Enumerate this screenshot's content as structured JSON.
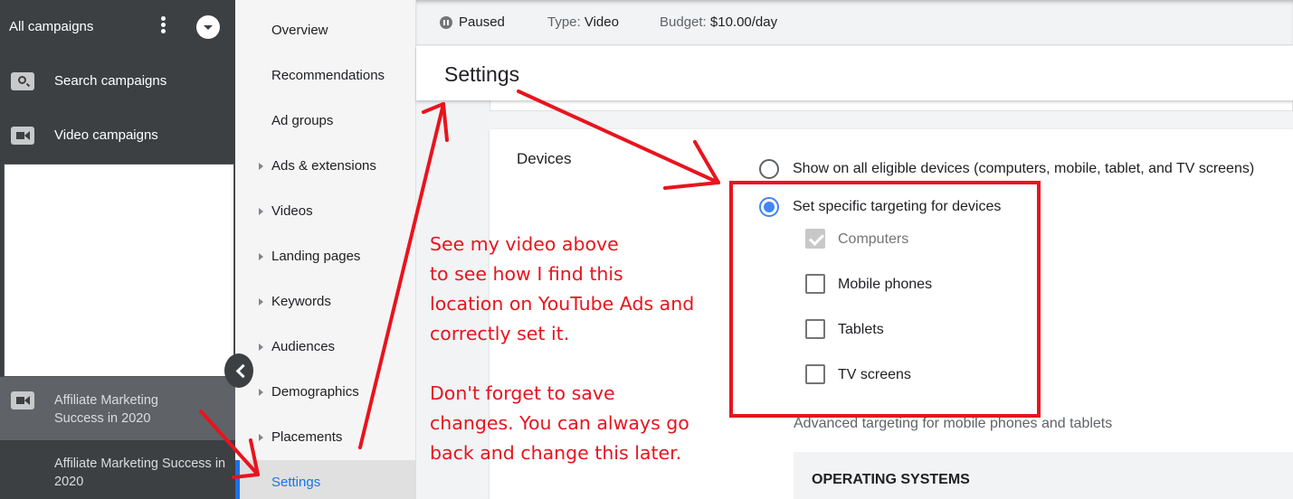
{
  "left_nav": {
    "title": "All campaigns",
    "more_icon": "kebab-vertical-icon",
    "dropdown_icon": "dropdown-circle-icon",
    "items": [
      {
        "label": "Search campaigns",
        "icon": "search-icon"
      },
      {
        "label": "Video campaigns",
        "icon": "video-camera-icon"
      }
    ],
    "campaign": {
      "label": "Affiliate Marketing Success in 2020",
      "icon": "video-camera-icon"
    },
    "ad_group": {
      "label": "Affiliate Marketing Success in 2020"
    },
    "collapse_icon": "chevron-left-icon"
  },
  "page_nav": {
    "items": [
      {
        "label": "Overview",
        "expandable": false
      },
      {
        "label": "Recommendations",
        "expandable": false
      },
      {
        "label": "Ad groups",
        "expandable": false
      },
      {
        "label": "Ads & extensions",
        "expandable": true
      },
      {
        "label": "Videos",
        "expandable": true
      },
      {
        "label": "Landing pages",
        "expandable": true
      },
      {
        "label": "Keywords",
        "expandable": true
      },
      {
        "label": "Audiences",
        "expandable": true
      },
      {
        "label": "Demographics",
        "expandable": true
      },
      {
        "label": "Placements",
        "expandable": true
      },
      {
        "label": "Settings",
        "expandable": false,
        "active": true
      }
    ]
  },
  "status_bar": {
    "status": "Paused",
    "status_icon": "pause-circle-icon",
    "type_label": "Type:",
    "type_value": "Video",
    "budget_label": "Budget:",
    "budget_value": "$10.00/day"
  },
  "settings": {
    "title": "Settings",
    "devices": {
      "label": "Devices",
      "options": [
        {
          "label": "Show on all eligible devices (computers, mobile, tablet, and TV screens)",
          "selected": false
        },
        {
          "label": "Set specific targeting for devices",
          "selected": true
        }
      ],
      "checkboxes": [
        {
          "label": "Computers",
          "checked": true,
          "disabled": true
        },
        {
          "label": "Mobile phones",
          "checked": false,
          "disabled": false
        },
        {
          "label": "Tablets",
          "checked": false,
          "disabled": false
        },
        {
          "label": "TV screens",
          "checked": false,
          "disabled": false
        }
      ],
      "advanced_text": "Advanced targeting for mobile phones and tablets",
      "os_heading": "OPERATING SYSTEMS"
    }
  },
  "annotations": {
    "color": "#e8141e",
    "note_1": "See my video above\nto see how I find this\nlocation on YouTube Ads and\ncorrectly set it.",
    "note_2": "Don't forget to save\nchanges. You can always go\nback and change this later."
  },
  "colors": {
    "sidebar_dark": "#3c4043",
    "accent_blue": "#1a73e8",
    "radio_blue": "#4285f4"
  }
}
